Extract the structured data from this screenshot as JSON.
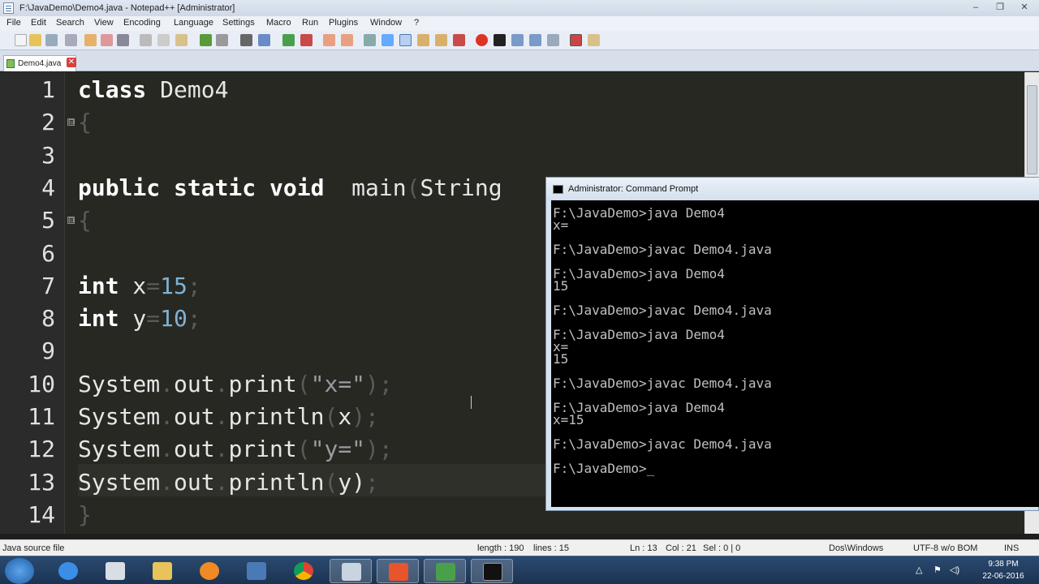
{
  "window": {
    "title": "F:\\JavaDemo\\Demo4.java - Notepad++ [Administrator]",
    "controls": [
      "–",
      "❐",
      "✕"
    ]
  },
  "menu": [
    "File",
    "Edit",
    "Search",
    "View",
    "Encoding",
    "Language",
    "Settings",
    "Macro",
    "Run",
    "Plugins",
    "Window",
    "?"
  ],
  "tab": {
    "label": "Demo4.java",
    "close": "✕"
  },
  "editor": {
    "line_numbers": [
      "1",
      "2",
      "3",
      "4",
      "5",
      "6",
      "7",
      "8",
      "9",
      "10",
      "11",
      "12",
      "13",
      "14"
    ],
    "fold_markers": [
      "⊟",
      "⊟"
    ],
    "lines": [
      [
        {
          "t": "class",
          "c": "kw"
        },
        {
          "t": " Demo4",
          "c": "id"
        }
      ],
      [
        {
          "t": "{",
          "c": "pn"
        }
      ],
      [],
      [
        {
          "t": "public static void",
          "c": "kw"
        },
        {
          "t": "  main",
          "c": "id"
        },
        {
          "t": "(",
          "c": "pn"
        },
        {
          "t": "String",
          "c": "id"
        }
      ],
      [
        {
          "t": "{",
          "c": "pn"
        }
      ],
      [],
      [
        {
          "t": "int",
          "c": "kw"
        },
        {
          "t": " x",
          "c": "id"
        },
        {
          "t": "=",
          "c": "pn"
        },
        {
          "t": "15",
          "c": "nm"
        },
        {
          "t": ";",
          "c": "pn"
        }
      ],
      [
        {
          "t": "int",
          "c": "kw"
        },
        {
          "t": " y",
          "c": "id"
        },
        {
          "t": "=",
          "c": "pn"
        },
        {
          "t": "10",
          "c": "nm"
        },
        {
          "t": ";",
          "c": "pn"
        }
      ],
      [],
      [
        {
          "t": "System",
          "c": "id"
        },
        {
          "t": ".",
          "c": "pn"
        },
        {
          "t": "out",
          "c": "id"
        },
        {
          "t": ".",
          "c": "pn"
        },
        {
          "t": "print",
          "c": "id"
        },
        {
          "t": "(",
          "c": "pn"
        },
        {
          "t": "\"x=\"",
          "c": "st"
        },
        {
          "t": ");",
          "c": "pn"
        }
      ],
      [
        {
          "t": "System",
          "c": "id"
        },
        {
          "t": ".",
          "c": "pn"
        },
        {
          "t": "out",
          "c": "id"
        },
        {
          "t": ".",
          "c": "pn"
        },
        {
          "t": "println",
          "c": "id"
        },
        {
          "t": "(",
          "c": "pn"
        },
        {
          "t": "x",
          "c": "id"
        },
        {
          "t": ");",
          "c": "pn"
        }
      ],
      [
        {
          "t": "System",
          "c": "id"
        },
        {
          "t": ".",
          "c": "pn"
        },
        {
          "t": "out",
          "c": "id"
        },
        {
          "t": ".",
          "c": "pn"
        },
        {
          "t": "print",
          "c": "id"
        },
        {
          "t": "(",
          "c": "pn"
        },
        {
          "t": "\"y=\"",
          "c": "st"
        },
        {
          "t": ");",
          "c": "pn"
        }
      ],
      [
        {
          "t": "System",
          "c": "id"
        },
        {
          "t": ".",
          "c": "pn"
        },
        {
          "t": "out",
          "c": "id"
        },
        {
          "t": ".",
          "c": "pn"
        },
        {
          "t": "println",
          "c": "id"
        },
        {
          "t": "(",
          "c": "pn"
        },
        {
          "t": "y",
          "c": "id"
        },
        {
          "t": ")",
          "c": "id"
        },
        {
          "t": ";",
          "c": "pn"
        }
      ],
      [
        {
          "t": "}",
          "c": "pn"
        }
      ]
    ]
  },
  "cmd": {
    "title": "Administrator: Command Prompt",
    "lines": [
      "F:\\JavaDemo>java Demo4",
      "x=",
      "",
      "F:\\JavaDemo>javac Demo4.java",
      "",
      "F:\\JavaDemo>java Demo4",
      "15",
      "",
      "F:\\JavaDemo>javac Demo4.java",
      "",
      "F:\\JavaDemo>java Demo4",
      "x=",
      "15",
      "",
      "F:\\JavaDemo>javac Demo4.java",
      "",
      "F:\\JavaDemo>java Demo4",
      "x=15",
      "",
      "F:\\JavaDemo>javac Demo4.java",
      "",
      "F:\\JavaDemo>_"
    ]
  },
  "status": {
    "file_type": "Java source file",
    "length": "length : 190",
    "lines": "lines : 15",
    "ln": "Ln : 13",
    "col": "Col : 21",
    "sel": "Sel : 0 | 0",
    "eol": "Dos\\Windows",
    "encoding": "UTF-8 w/o BOM",
    "mode": "INS"
  },
  "taskbar": {
    "apps": [
      "internet-explorer",
      "calculator",
      "explorer",
      "media-player",
      "remote-desktop",
      "chrome",
      "files",
      "office",
      "chart",
      "command-prompt"
    ],
    "tray_icons": [
      "△",
      "⚑",
      "◁)"
    ],
    "clock_time": "9:38 PM",
    "clock_date": "22-06-2016"
  },
  "colors": {
    "editor_bg": "#272822",
    "cmd_bg": "#000000",
    "keyword": "#ffffff",
    "number": "#7fb2d4"
  }
}
